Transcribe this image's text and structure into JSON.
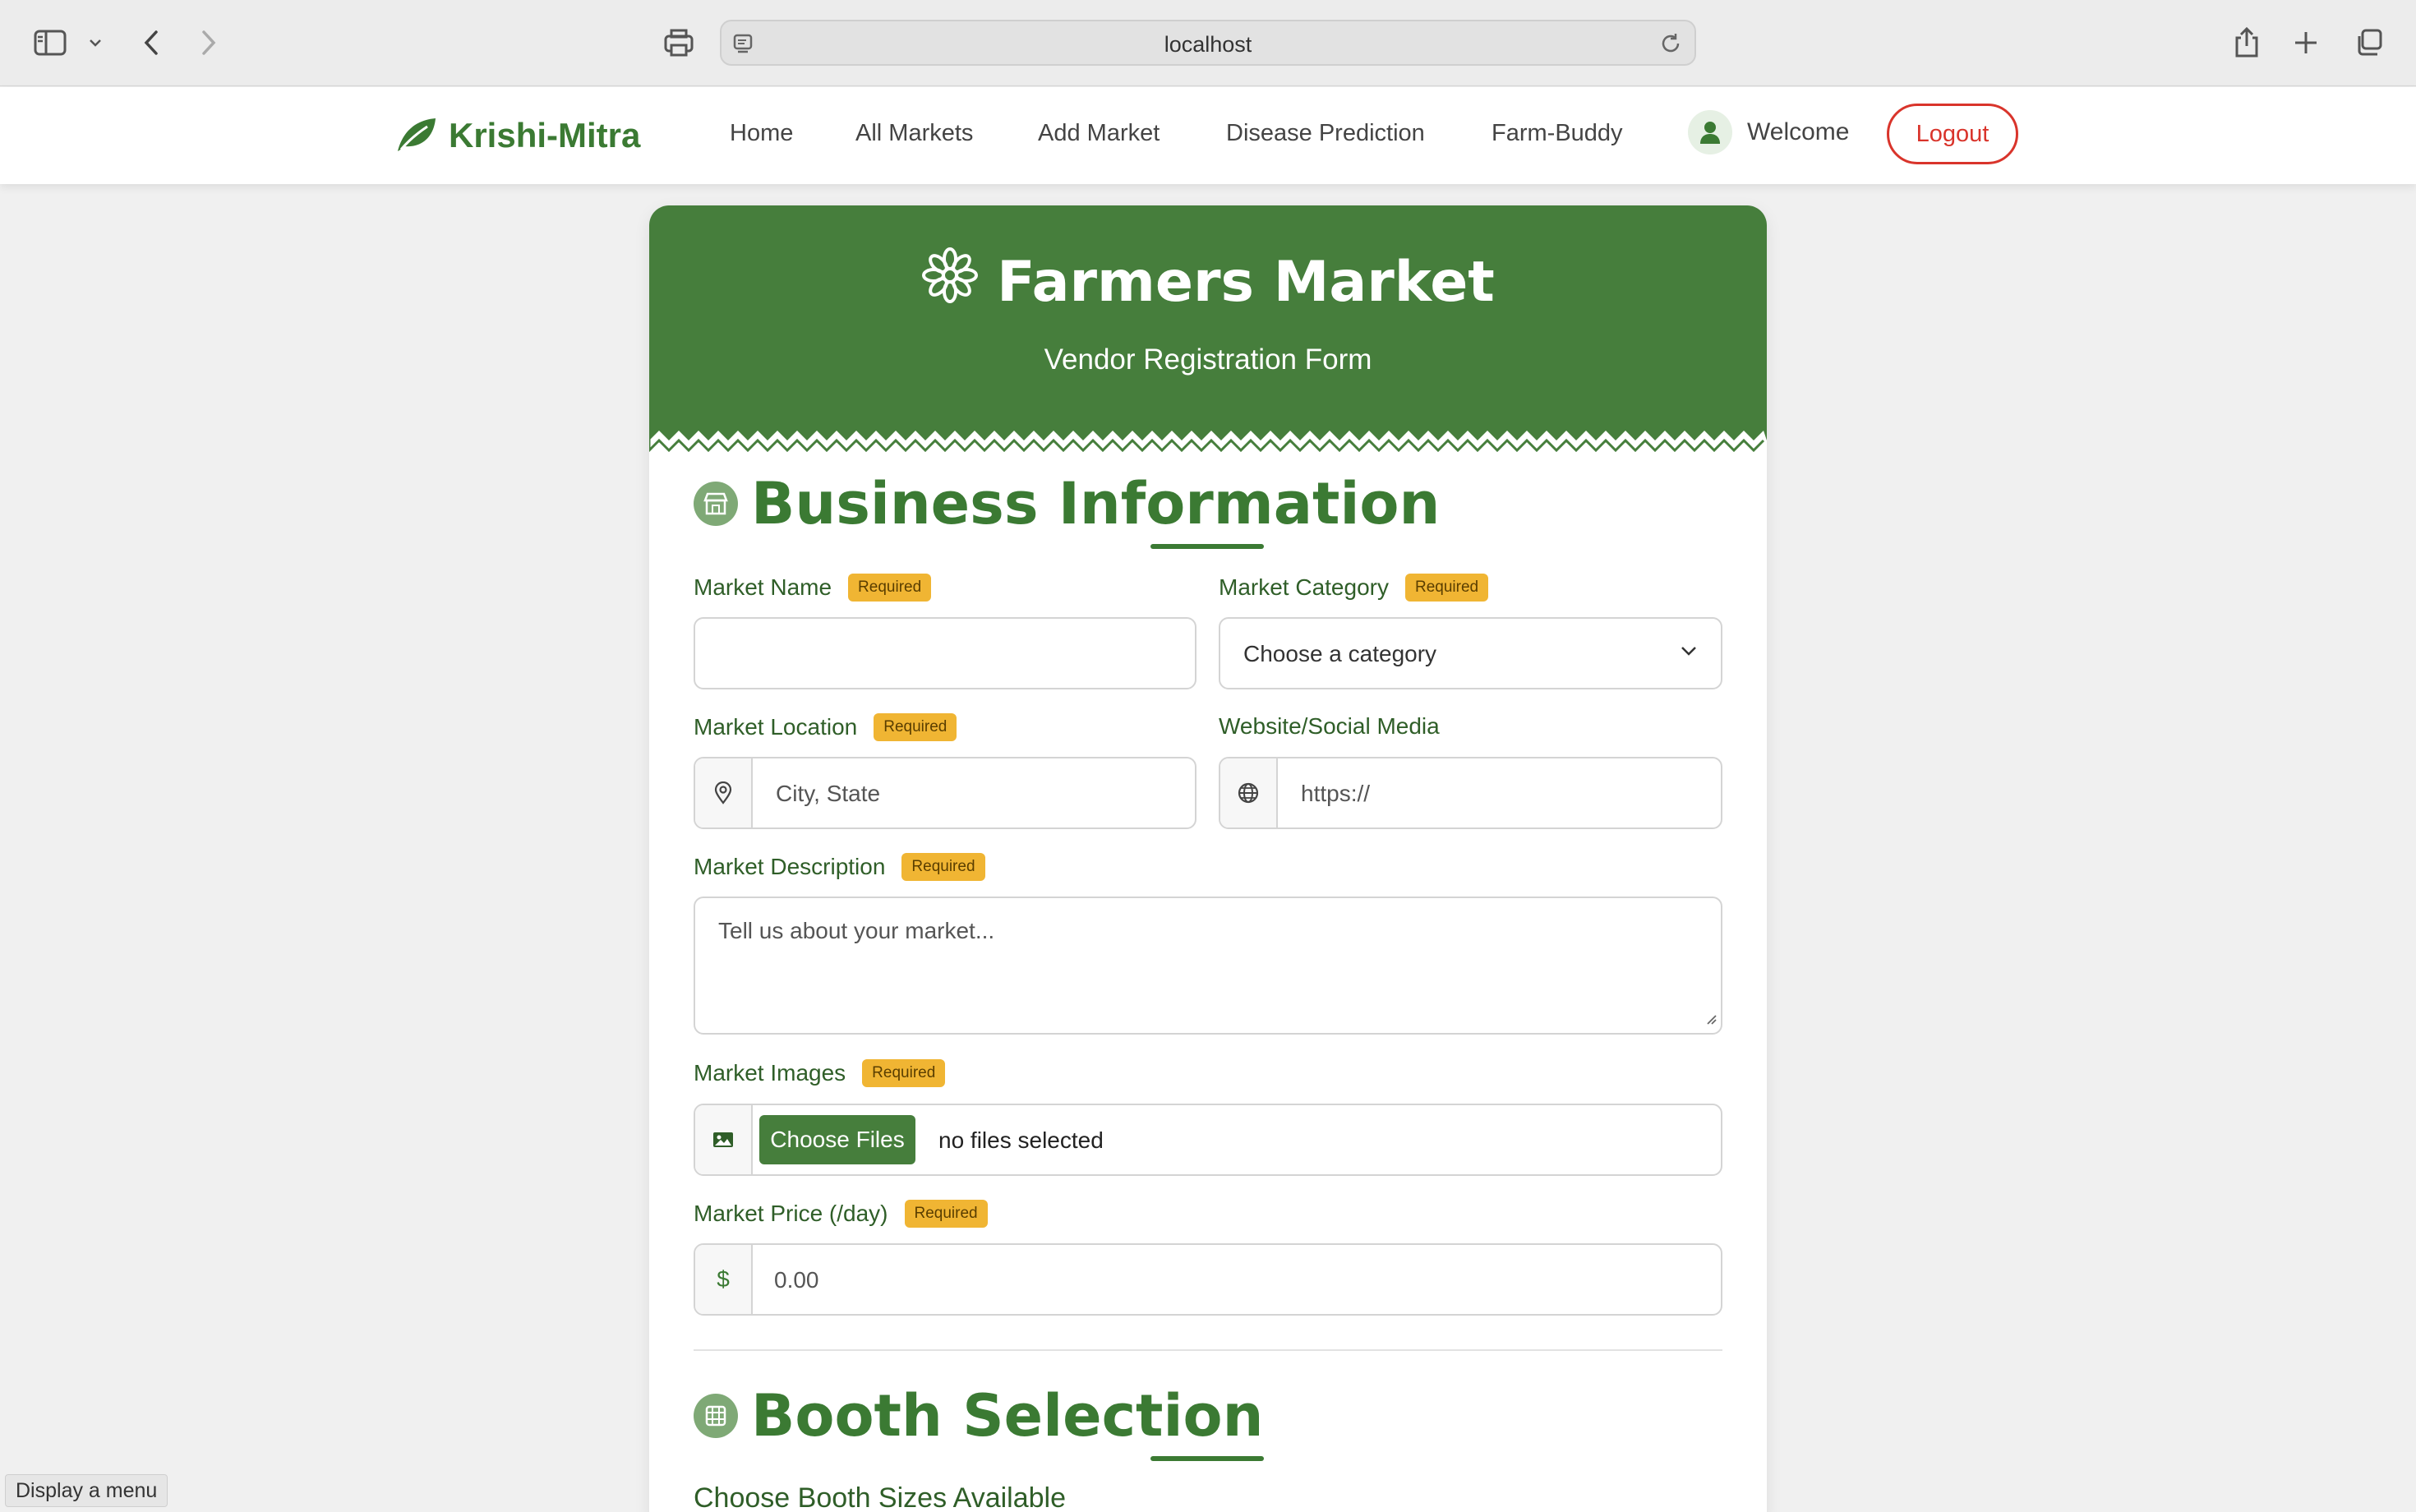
{
  "browser": {
    "url": "localhost"
  },
  "navbar": {
    "brand": "Krishi-Mitra",
    "links": [
      "Home",
      "All Markets",
      "Add Market",
      "Disease Prediction",
      "Farm-Buddy"
    ],
    "welcome": "Welcome",
    "logout": "Logout"
  },
  "header": {
    "title": "Farmers Market",
    "subtitle": "Vendor Registration Form"
  },
  "business": {
    "title": "Business Information",
    "required_badge": "Required",
    "market_name": {
      "label": "Market Name",
      "value": ""
    },
    "market_category": {
      "label": "Market Category",
      "selected": "Choose a category"
    },
    "market_location": {
      "label": "Market Location",
      "placeholder": "City, State"
    },
    "website": {
      "label": "Website/Social Media",
      "placeholder": "https://"
    },
    "description": {
      "label": "Market Description",
      "placeholder": "Tell us about your market..."
    },
    "images": {
      "label": "Market Images",
      "button": "Choose Files",
      "status": "no files selected"
    },
    "price": {
      "label": "Market Price (/day)",
      "currency": "$",
      "placeholder": "0.00"
    }
  },
  "booth": {
    "title": "Booth Selection",
    "subtitle": "Choose Booth Sizes Available"
  },
  "status_tooltip": "Display a menu",
  "colors": {
    "primary_green": "#467e3c",
    "required_badge": "#f0b533",
    "logout_red": "#d9342b"
  }
}
